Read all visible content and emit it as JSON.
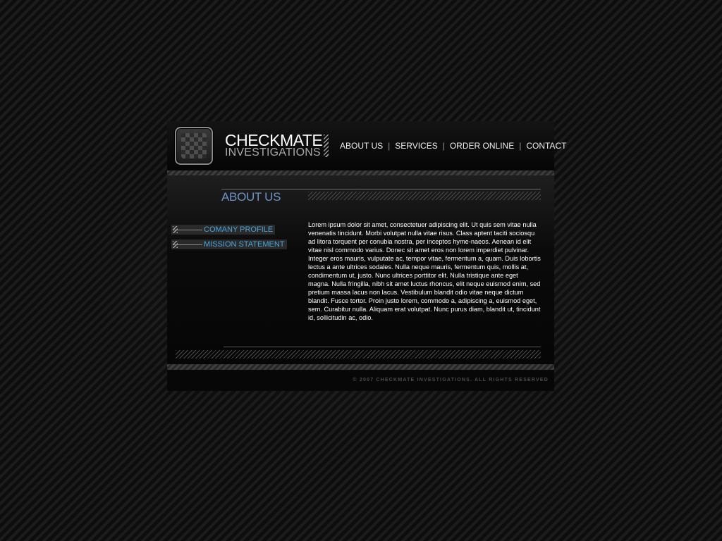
{
  "brand": {
    "line1": "CHECKMATE",
    "line2": "INVESTIGATIONS"
  },
  "nav": {
    "items": [
      {
        "label": "ABOUT US"
      },
      {
        "label": "SERVICES"
      },
      {
        "label": "ORDER ONLINE"
      },
      {
        "label": "CONTACT"
      }
    ],
    "separator": "|"
  },
  "main": {
    "title": "ABOUT US",
    "sidebar": [
      {
        "label": "COMANY PROFILE"
      },
      {
        "label": "MISSION STATEMENT"
      }
    ],
    "body": "Lorem ipsum dolor sit amet, consectetuer adipiscing elit. Ut quis sem vitae nulla venenatis tincidunt. Morbi volutpat nulla vitae risus. Class aptent taciti sociosqu ad litora torquent per conubia nostra, per inceptos hyme-naeos. Aenean id elit vitae nisl commodo varius. Donec sit amet eros non lorem imperdiet pulvinar. Integer eros mauris, vulputate ac, tempor vitae, fermentum a, quam. Duis lobortis lectus a ante ultrices sodales. Nulla neque mauris, fermentum quis, mollis at, condimentum ut, justo. Nunc ultrices porttitor elit. Nulla tristique ante eget magna. Nulla fringilla, nibh sit amet luctus rhoncus, elit neque euismod enim, sed pretium massa lacus non lacus. Vestibulum blandit odio vitae neque dictum blandit. Fusce tortor. Proin justo lorem, commodo a, adipiscing a, euismod eget, sem. Curabitur nulla. Aliquam erat volutpat. Nunc purus diam, blandit ut, tincidunt id, sollicitudin ac, odio."
  },
  "footer": {
    "copyright": "© 2007 CHECKMATE INVESTIGATIONS. ALL RIGHTS RESERVED"
  },
  "colors": {
    "accent_title": "#6f93c8",
    "accent_link": "#4aa5de",
    "background": "#121212",
    "text": "#ffffff"
  },
  "icons": {
    "logo": "checkerboard-logo-icon",
    "divider": "hatch-divider-icon"
  }
}
